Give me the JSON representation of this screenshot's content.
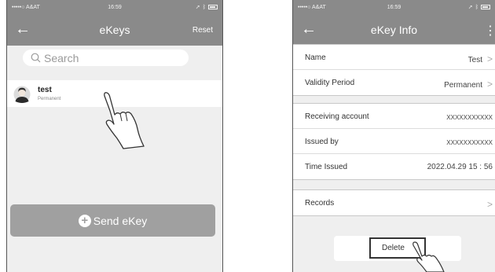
{
  "left_screen": {
    "status": {
      "carrier": "•••••○ A&AT",
      "time": "16:59"
    },
    "nav": {
      "back_icon": "back-arrow",
      "title": "eKeys",
      "action": "Reset"
    },
    "search": {
      "placeholder": "Search"
    },
    "ekeys": [
      {
        "name": "test",
        "validity": "Permanent"
      }
    ],
    "send_button": "Send eKey"
  },
  "right_screen": {
    "status": {
      "carrier": "•••••○ A&AT",
      "time": "16:59"
    },
    "nav": {
      "back_icon": "back-arrow",
      "title": "eKey Info",
      "more_icon": "more-vertical"
    },
    "group1": [
      {
        "label": "Name",
        "value": "Test"
      },
      {
        "label": "Validity Period",
        "value": "Permanent"
      }
    ],
    "group2": [
      {
        "label": "Receiving account",
        "value": "XXXXXXXXXXX"
      },
      {
        "label": "Issued by",
        "value": "XXXXXXXXXXX"
      },
      {
        "label": "Time Issued",
        "value": "2022.04.29 15 : 56"
      }
    ],
    "group3": [
      {
        "label": "Records",
        "value": ""
      }
    ],
    "delete_button": "Delete"
  }
}
